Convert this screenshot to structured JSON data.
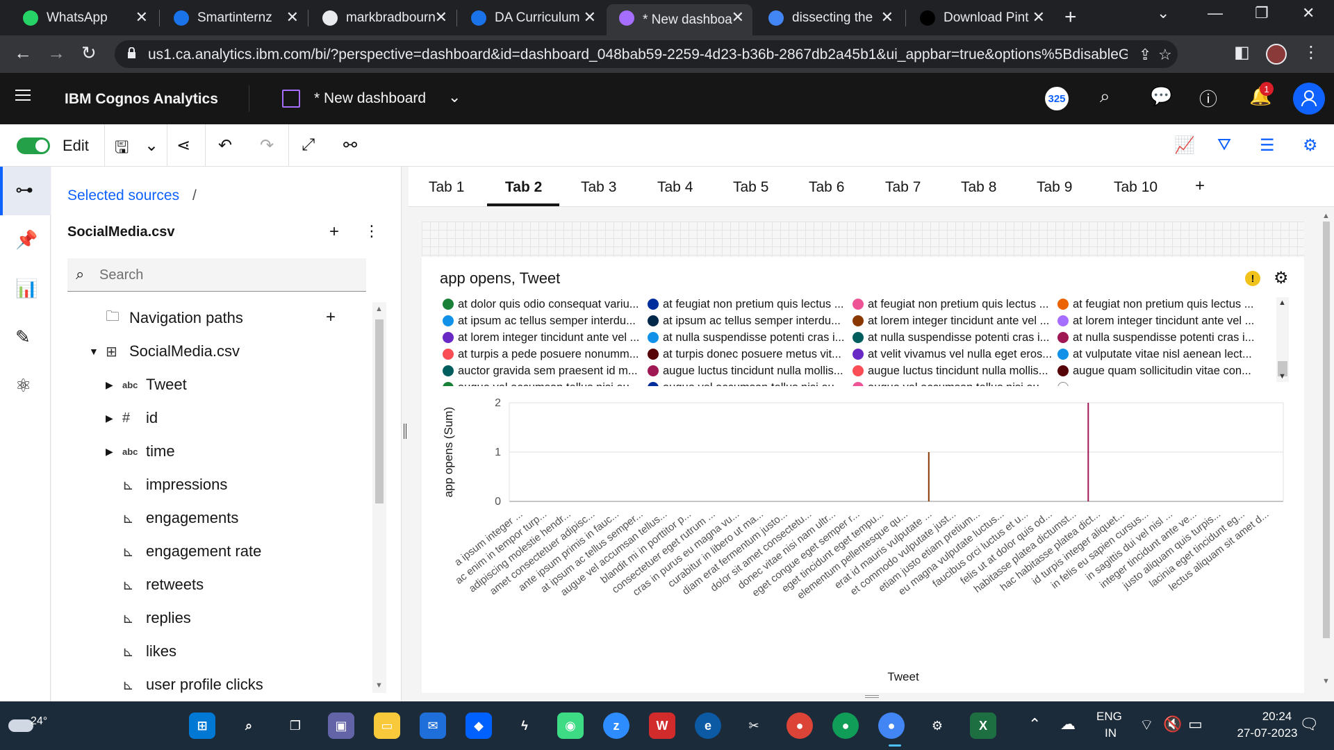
{
  "browser": {
    "tabs": [
      {
        "title": "WhatsApp",
        "icon": "whatsapp-icon",
        "color": "#25d366"
      },
      {
        "title": "Smartinternz",
        "icon": "smartinternz-icon",
        "color": "#1a73e8"
      },
      {
        "title": "markbradbourn",
        "icon": "github-icon",
        "color": "#e8eaed"
      },
      {
        "title": "DA Curriculum",
        "icon": "curriculum-icon",
        "color": "#1a73e8"
      },
      {
        "title": "* New dashboa",
        "icon": "cognos-icon",
        "color": "#a56eff"
      },
      {
        "title": "dissecting the",
        "icon": "google-icon",
        "color": "#4285f4"
      },
      {
        "title": "Download Pint",
        "icon": "g-icon",
        "color": "#000000"
      }
    ],
    "url": "us1.ca.analytics.ibm.com/bi/?perspective=dashboard&id=dashboard_048bab59-2259-4d23-b36b-2867db2a45b1&ui_appbar=true&options%5BdisableGl..."
  },
  "app": {
    "brand": "IBM Cognos Analytics",
    "dashboard_name": "* New dashboard",
    "user_count": "325",
    "notification_count": "1"
  },
  "toolbar": {
    "edit_label": "Edit"
  },
  "data_panel": {
    "breadcrumb": "Selected sources",
    "breadcrumb_sep": "/",
    "source_name": "SocialMedia.csv",
    "search_placeholder": "Search",
    "tree": [
      {
        "label": "Navigation paths",
        "icon": "folder-icon",
        "indent": 0,
        "caret": ""
      },
      {
        "label": "SocialMedia.csv",
        "icon": "table-icon",
        "indent": 0,
        "caret": "▼"
      },
      {
        "label": "Tweet",
        "icon": "abc-icon",
        "indent": 1,
        "caret": "▶"
      },
      {
        "label": "id",
        "icon": "hash-icon",
        "indent": 1,
        "caret": "▶"
      },
      {
        "label": "time",
        "icon": "abc-icon",
        "indent": 1,
        "caret": "▶"
      },
      {
        "label": "impressions",
        "icon": "measure-icon",
        "indent": 1,
        "caret": ""
      },
      {
        "label": "engagements",
        "icon": "measure-icon",
        "indent": 1,
        "caret": ""
      },
      {
        "label": "engagement rate",
        "icon": "measure-icon",
        "indent": 1,
        "caret": ""
      },
      {
        "label": "retweets",
        "icon": "measure-icon",
        "indent": 1,
        "caret": ""
      },
      {
        "label": "replies",
        "icon": "measure-icon",
        "indent": 1,
        "caret": ""
      },
      {
        "label": "likes",
        "icon": "measure-icon",
        "indent": 1,
        "caret": ""
      },
      {
        "label": "user profile clicks",
        "icon": "measure-icon",
        "indent": 1,
        "caret": ""
      }
    ]
  },
  "dashboard_tabs": [
    "Tab 1",
    "Tab 2",
    "Tab 3",
    "Tab 4",
    "Tab 5",
    "Tab 6",
    "Tab 7",
    "Tab 8",
    "Tab 9",
    "Tab 10"
  ],
  "active_tab": "Tab 2",
  "widget": {
    "title": "app opens, Tweet",
    "legend": [
      {
        "label": "at dolor quis odio consequat variu...",
        "color": "#198038"
      },
      {
        "label": "at feugiat non pretium quis lectus ...",
        "color": "#002d9c"
      },
      {
        "label": "at feugiat non pretium quis lectus ...",
        "color": "#ee5396"
      },
      {
        "label": "at feugiat non pretium quis lectus ...",
        "color": "#eb6200"
      },
      {
        "label": "at ipsum ac tellus semper interdu...",
        "color": "#1192e8"
      },
      {
        "label": "at ipsum ac tellus semper interdu...",
        "color": "#012749"
      },
      {
        "label": "at lorem integer tincidunt ante vel ...",
        "color": "#8a3800"
      },
      {
        "label": "at lorem integer tincidunt ante vel ...",
        "color": "#a56eff"
      },
      {
        "label": "at lorem integer tincidunt ante vel ...",
        "color": "#6929c4"
      },
      {
        "label": "at nulla suspendisse potenti cras i...",
        "color": "#1192e8"
      },
      {
        "label": "at nulla suspendisse potenti cras i...",
        "color": "#005d5d"
      },
      {
        "label": "at nulla suspendisse potenti cras i...",
        "color": "#9f1853"
      },
      {
        "label": "at turpis a pede posuere nonumm...",
        "color": "#fa4d56"
      },
      {
        "label": "at turpis donec posuere metus vit...",
        "color": "#570408"
      },
      {
        "label": "at velit vivamus vel nulla eget eros...",
        "color": "#6929c4"
      },
      {
        "label": "at vulputate vitae nisl aenean lect...",
        "color": "#1192e8"
      },
      {
        "label": "auctor gravida sem praesent id m...",
        "color": "#005d5d"
      },
      {
        "label": "augue luctus tincidunt nulla mollis...",
        "color": "#9f1853"
      },
      {
        "label": "augue luctus tincidunt nulla mollis...",
        "color": "#fa4d56"
      },
      {
        "label": "augue quam sollicitudin vitae con...",
        "color": "#570408"
      },
      {
        "label": "augue vel accumsan tellus nisi eu ...",
        "color": "#198038"
      },
      {
        "label": "augue vel accumsan tellus nisi eu ...",
        "color": "#002d9c"
      },
      {
        "label": "augue vel accumsan tellus nisi eu ...",
        "color": "#ee5396"
      },
      {
        "label": "...",
        "color": "#ffffff"
      }
    ]
  },
  "chart_data": {
    "type": "bar",
    "xlabel": "Tweet",
    "ylabel": "app opens (Sum)",
    "ylim": [
      0,
      2
    ],
    "yticks": [
      0,
      1,
      2
    ],
    "grid": true,
    "categories": [
      "a ipsum integer ...",
      "ac enim in tempor turp...",
      "adipiscing molestie hendr...",
      "amet consectetuer adipisc...",
      "ante ipsum primis in fauc...",
      "at ipsum ac tellus semper...",
      "augue vel accumsan tellus...",
      "blandit mi in porttitor p...",
      "consectetuer eget rutrum ...",
      "cras in purus eu magna vu...",
      "curabitur in libero ut ma...",
      "diam erat fermentum justo...",
      "dolor sit amet consectetu...",
      "donec vitae nisi nam ultr...",
      "eget congue eget semper r...",
      "eget tincidunt eget tempu...",
      "elementum pellentesque qu...",
      "erat id mauris vulputate ...",
      "et commodo vulputate just...",
      "etiam justo etiam pretium...",
      "eu magna vulputate luctus...",
      "faucibus orci luctus et u...",
      "felis ut at dolor quis od...",
      "habitasse platea dictumst...",
      "hac habitasse platea dict...",
      "id turpis integer aliquet...",
      "in felis eu sapien cursus...",
      "in sagittis dui vel nisl ...",
      "integer tincidunt ante ve...",
      "justo aliquam quis turpis...",
      "lacinia eget tincidunt eg...",
      "lectus aliquam sit amet d..."
    ],
    "bars": [
      {
        "x_fraction": 0.542,
        "value": 1,
        "color": "#8a3800"
      },
      {
        "x_fraction": 0.748,
        "value": 2,
        "color": "#9f1853"
      }
    ]
  },
  "taskbar": {
    "temperature": "24°",
    "lang_line1": "ENG",
    "lang_line2": "IN",
    "time": "20:24",
    "date": "27-07-2023"
  }
}
